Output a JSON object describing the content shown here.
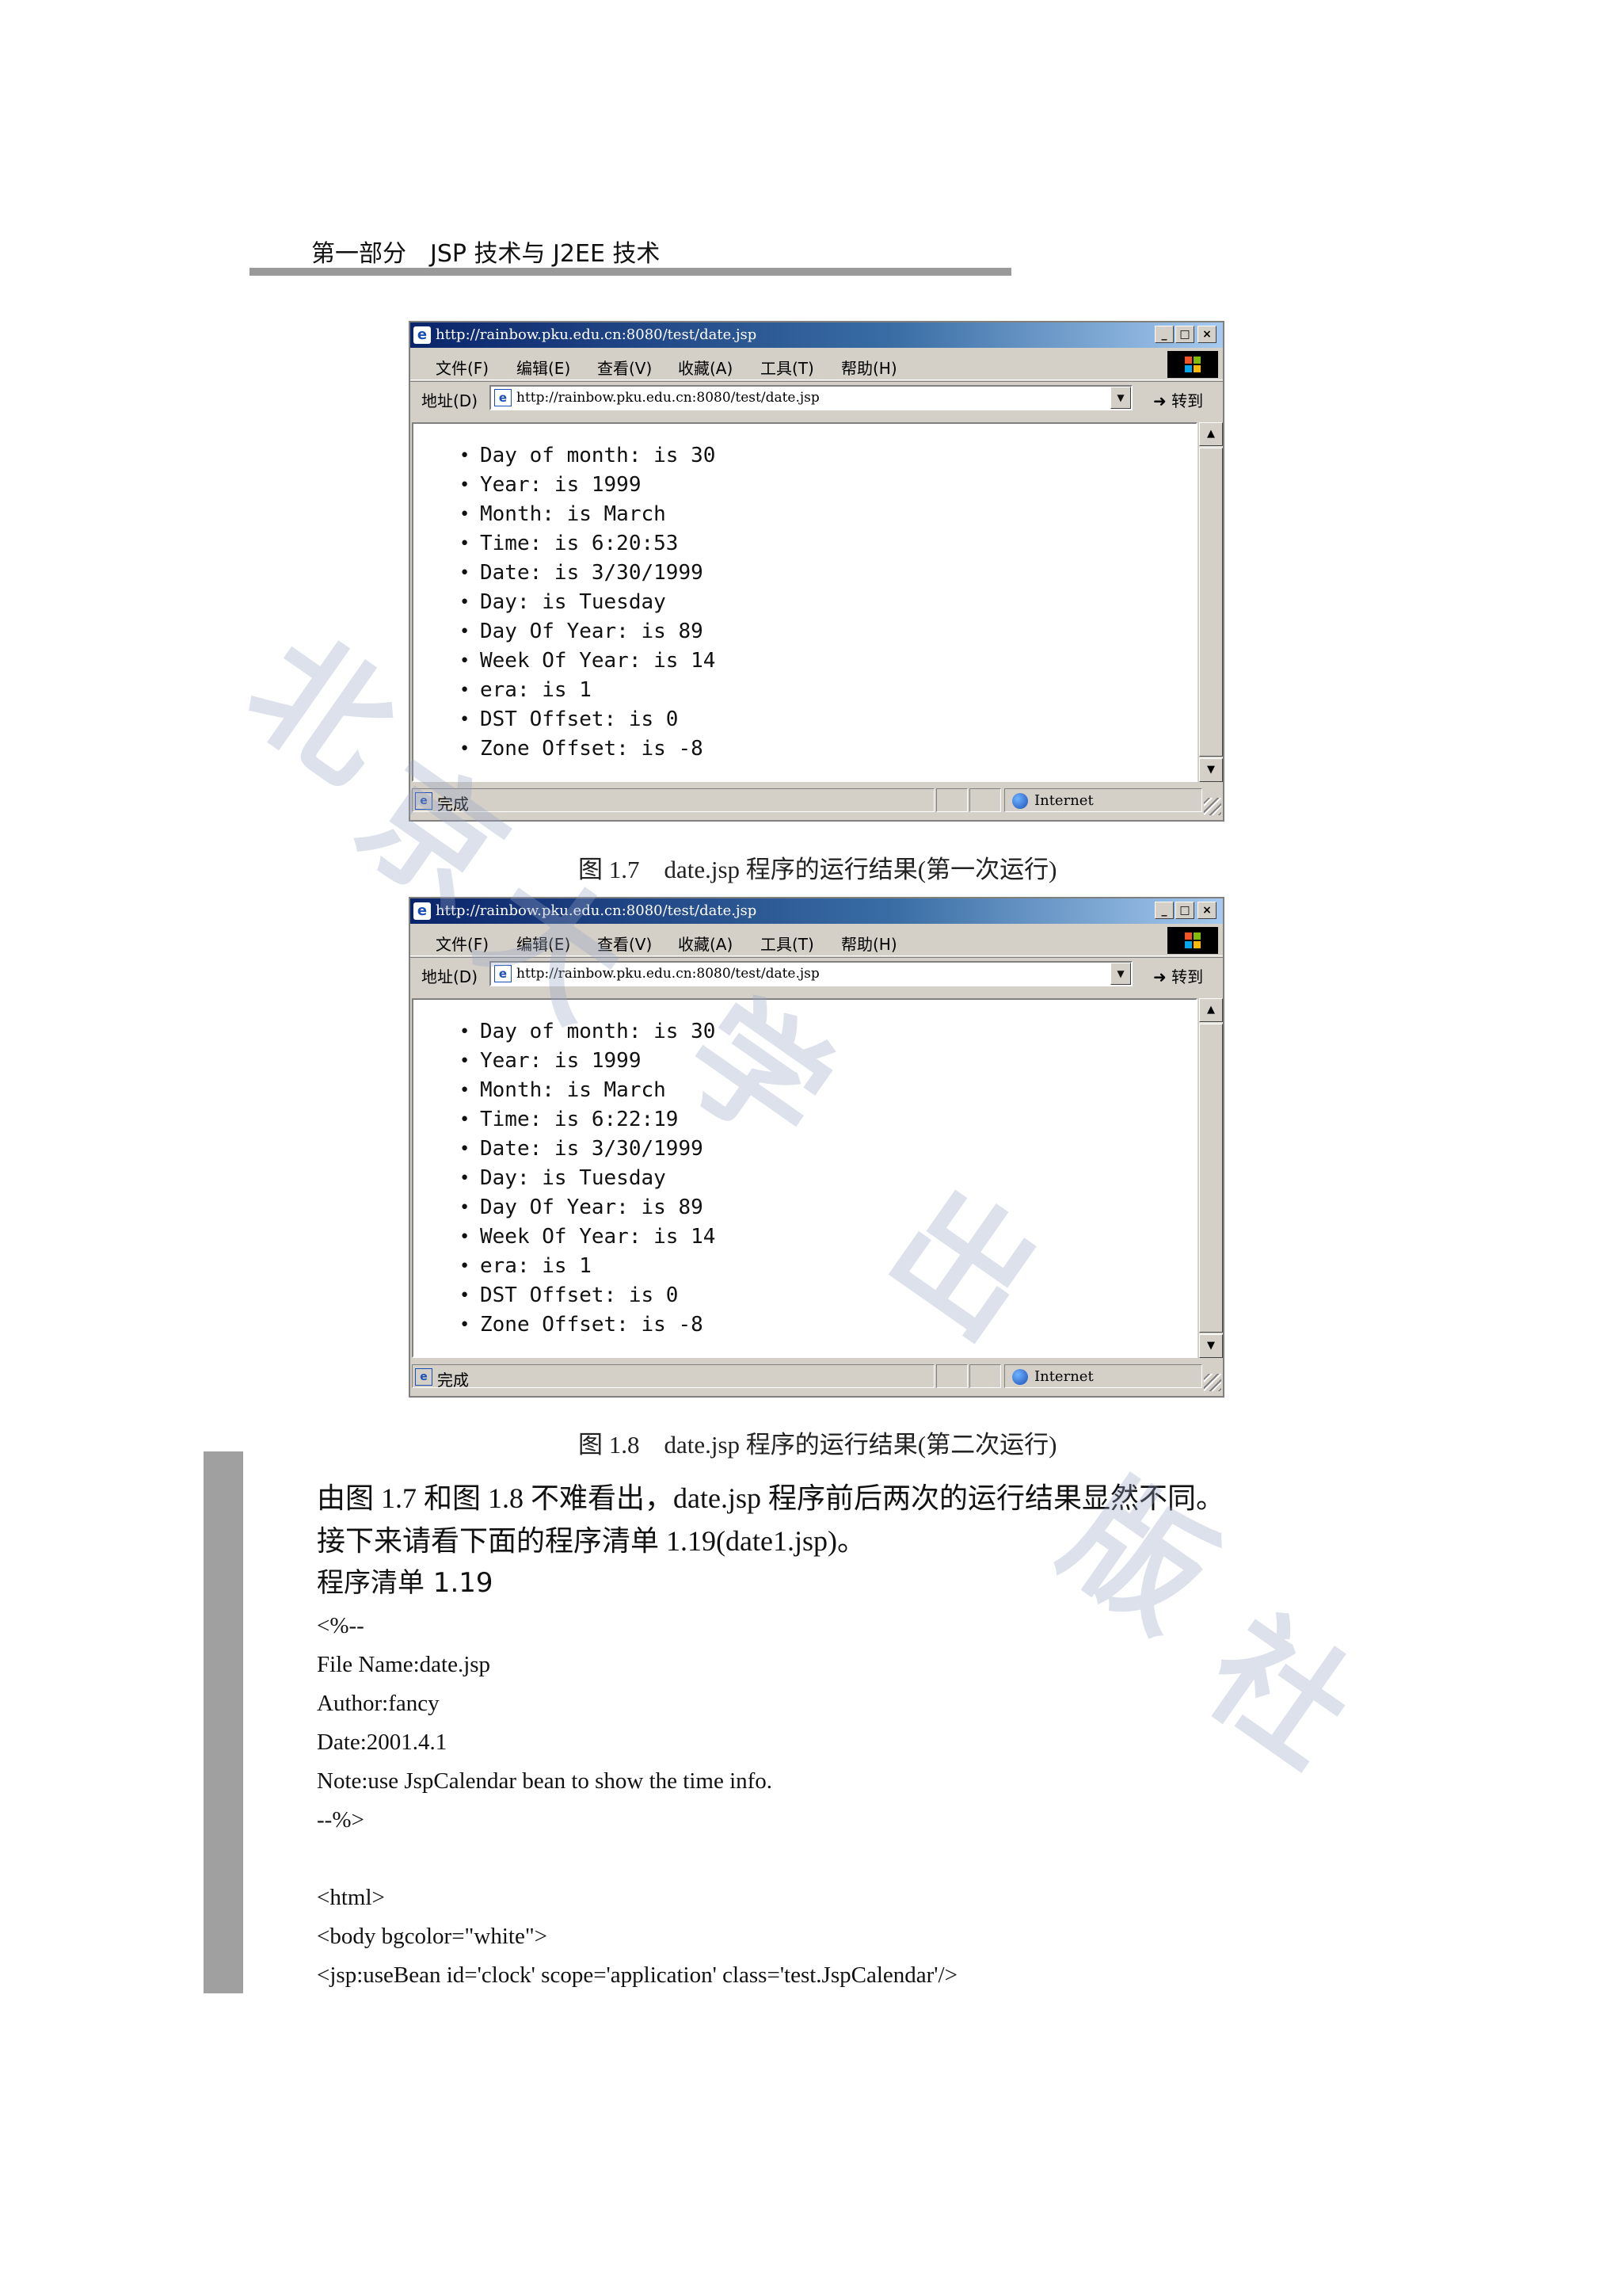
{
  "header": {
    "title": "第一部分　JSP 技术与 J2EE 技术"
  },
  "browser": {
    "title_url": "http://rainbow.pku.edu.cn:8080/test/date.jsp",
    "menu": [
      "文件(F)",
      "编辑(E)",
      "查看(V)",
      "收藏(A)",
      "工具(T)",
      "帮助(H)"
    ],
    "address_label": "地址(D)",
    "address_url": "http://rainbow.pku.edu.cn:8080/test/date.jsp",
    "go_label": "转到",
    "status_text": "完成",
    "zone_text": "Internet"
  },
  "figure1": {
    "items": [
      "Day of month: is 30",
      "Year: is 1999",
      "Month: is March",
      "Time: is 6:20:53",
      "Date: is 3/30/1999",
      "Day: is Tuesday",
      "Day Of Year: is 89",
      "Week Of Year: is 14",
      "era: is 1",
      "DST Offset: is 0",
      "Zone Offset: is -8"
    ],
    "caption": "图 1.7　date.jsp 程序的运行结果(第一次运行)"
  },
  "figure2": {
    "items": [
      "Day of month: is 30",
      "Year: is 1999",
      "Month: is March",
      "Time: is 6:22:19",
      "Date: is 3/30/1999",
      "Day: is Tuesday",
      "Day Of Year: is 89",
      "Week Of Year: is 14",
      "era: is 1",
      "DST Offset: is 0",
      "Zone Offset: is -8"
    ],
    "caption": "图 1.8　date.jsp 程序的运行结果(第二次运行)"
  },
  "body": {
    "paragraph1": "由图 1.7 和图 1.8 不难看出，date.jsp 程序前后两次的运行结果显然不同。",
    "paragraph2": "接下来请看下面的程序清单 1.19(date1.jsp)。",
    "listing_title": "程序清单 1.19"
  },
  "code": [
    "<%--",
    "File Name:date.jsp",
    "Author:fancy",
    "Date:2001.4.1",
    "Note:use JspCalendar bean to show the time info.",
    "--%>",
    "",
    "<html>",
    "<body bgcolor=\"white\">",
    "<jsp:useBean id='clock' scope='application' class='test.JspCalendar'/>"
  ],
  "watermark": [
    "北",
    "京",
    "大",
    "学",
    "出",
    "版",
    "社"
  ]
}
